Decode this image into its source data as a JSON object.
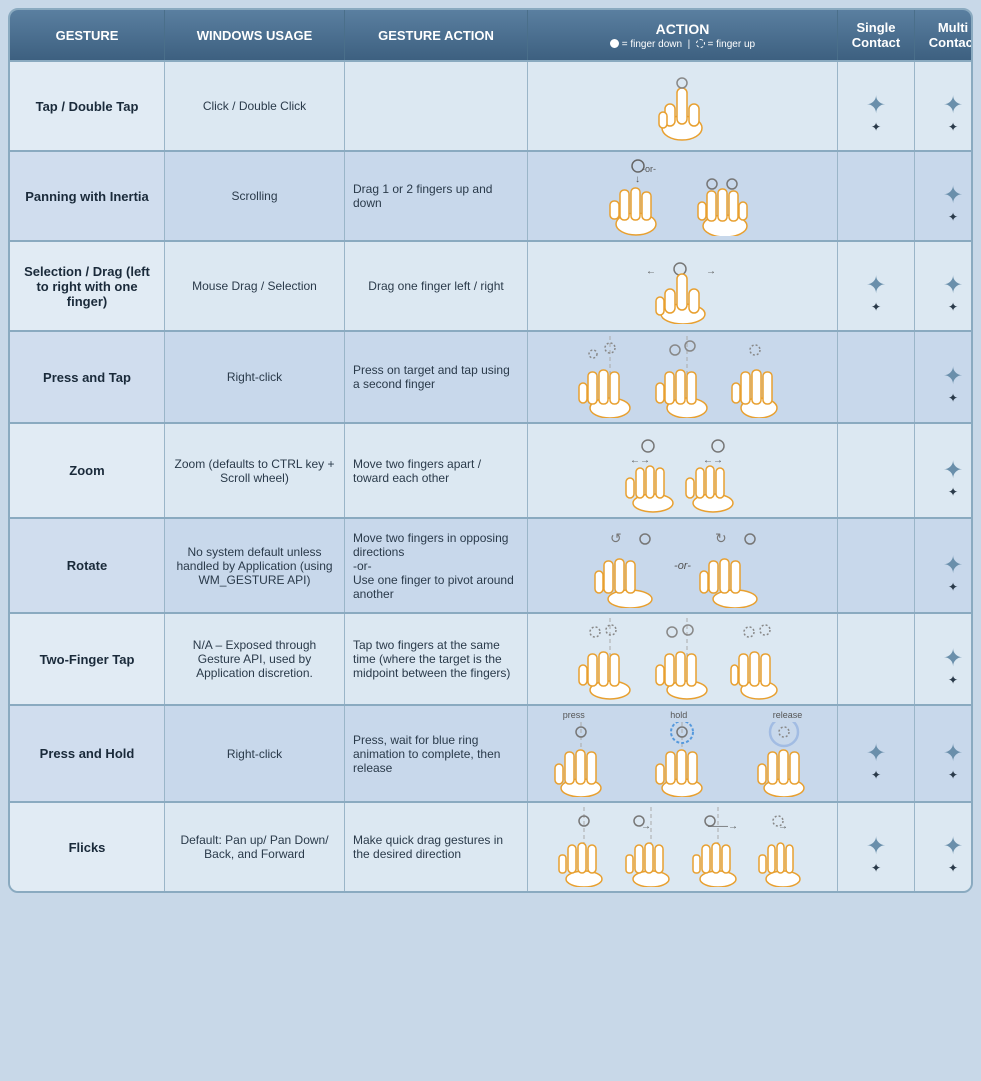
{
  "header": {
    "col1": "GESTURE",
    "col2": "WINDOWS USAGE",
    "col3": "GESTURE ACTION",
    "col4_main": "ACTION",
    "col4_sub": "( = finger down |  = finger up)",
    "col5": "Single Contact",
    "col6": "Multi Contact"
  },
  "rows": [
    {
      "gesture": "Tap / Double Tap",
      "windows": "Click / Double Click",
      "action": "",
      "single": true,
      "multi": true
    },
    {
      "gesture": "Panning with Inertia",
      "windows": "Scrolling",
      "action": "Drag 1 or 2 fingers up and down",
      "single": false,
      "multi": true
    },
    {
      "gesture": "Selection / Drag (left to right with one finger)",
      "windows": "Mouse Drag / Selection",
      "action": "Drag one finger left / right",
      "single": true,
      "multi": true
    },
    {
      "gesture": "Press and Tap",
      "windows": "Right-click",
      "action": "Press on target and tap using a second finger",
      "single": false,
      "multi": true
    },
    {
      "gesture": "Zoom",
      "windows": "Zoom (defaults to CTRL key + Scroll wheel)",
      "action": "Move two fingers apart / toward each other",
      "single": false,
      "multi": true
    },
    {
      "gesture": "Rotate",
      "windows": "No system default unless handled by Application (using WM_GESTURE API)",
      "action": "Move two fingers in opposing directions\n-or-\nUse one finger to pivot around another",
      "single": false,
      "multi": true
    },
    {
      "gesture": "Two-Finger Tap",
      "windows": "N/A – Exposed through Gesture API, used by Application discretion.",
      "action": "Tap two fingers at the same time (where the target is the midpoint between the fingers)",
      "single": false,
      "multi": true
    },
    {
      "gesture": "Press and Hold",
      "windows": "Right-click",
      "action": "Press, wait for blue ring animation to complete, then release",
      "single": true,
      "multi": true
    },
    {
      "gesture": "Flicks",
      "windows": "Default: Pan up/ Pan Down/ Back, and Forward",
      "action": "Make quick drag gestures in the desired direction",
      "single": true,
      "multi": true
    }
  ]
}
